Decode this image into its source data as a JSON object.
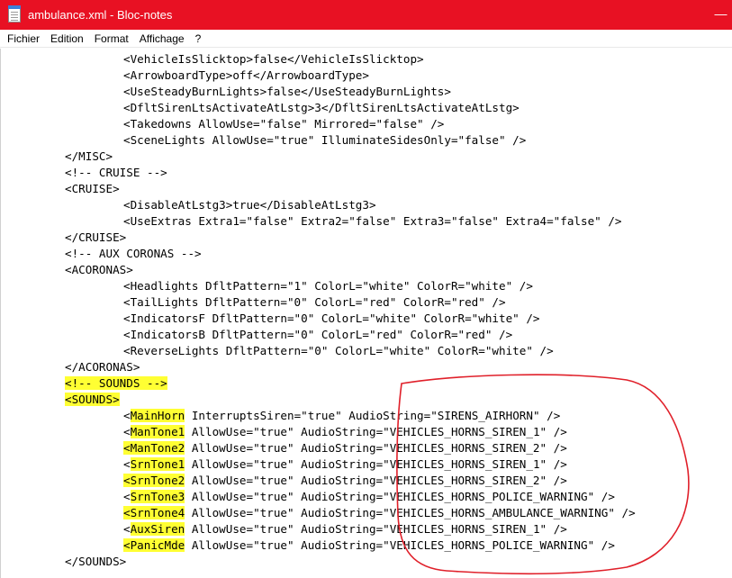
{
  "window": {
    "title": "ambulance.xml - Bloc-notes",
    "minimize_glyph": "—"
  },
  "menu": [
    "Fichier",
    "Edition",
    "Format",
    "Affichage",
    "?"
  ],
  "lines": [
    {
      "indent": 2,
      "segments": [
        {
          "t": "<VehicleIsSlicktop>false</VehicleIsSlicktop>"
        }
      ]
    },
    {
      "indent": 2,
      "segments": [
        {
          "t": "<ArrowboardType>off</ArrowboardType>"
        }
      ]
    },
    {
      "indent": 2,
      "segments": [
        {
          "t": "<UseSteadyBurnLights>false</UseSteadyBurnLights>"
        }
      ]
    },
    {
      "indent": 2,
      "segments": [
        {
          "t": "<DfltSirenLtsActivateAtLstg>3</DfltSirenLtsActivateAtLstg>"
        }
      ]
    },
    {
      "indent": 2,
      "segments": [
        {
          "t": "<Takedowns AllowUse=\"false\" Mirrored=\"false\" />"
        }
      ]
    },
    {
      "indent": 2,
      "segments": [
        {
          "t": "<SceneLights AllowUse=\"true\" IlluminateSidesOnly=\"false\" />"
        }
      ]
    },
    {
      "indent": 1,
      "segments": [
        {
          "t": "</MISC>"
        }
      ]
    },
    {
      "indent": 1,
      "segments": [
        {
          "t": "<!-- CRUISE -->"
        }
      ]
    },
    {
      "indent": 1,
      "segments": [
        {
          "t": "<CRUISE>"
        }
      ]
    },
    {
      "indent": 2,
      "segments": [
        {
          "t": "<DisableAtLstg3>true</DisableAtLstg3>"
        }
      ]
    },
    {
      "indent": 2,
      "segments": [
        {
          "t": "<UseExtras Extra1=\"false\" Extra2=\"false\" Extra3=\"false\" Extra4=\"false\" />"
        }
      ]
    },
    {
      "indent": 1,
      "segments": [
        {
          "t": "</CRUISE>"
        }
      ]
    },
    {
      "indent": 1,
      "segments": [
        {
          "t": "<!-- AUX CORONAS -->"
        }
      ]
    },
    {
      "indent": 1,
      "segments": [
        {
          "t": "<ACORONAS>"
        }
      ]
    },
    {
      "indent": 2,
      "segments": [
        {
          "t": "<Headlights DfltPattern=\"1\" ColorL=\"white\" ColorR=\"white\" />"
        }
      ]
    },
    {
      "indent": 2,
      "segments": [
        {
          "t": "<TailLights DfltPattern=\"0\" ColorL=\"red\" ColorR=\"red\" />"
        }
      ]
    },
    {
      "indent": 2,
      "segments": [
        {
          "t": "<IndicatorsF DfltPattern=\"0\" ColorL=\"white\" ColorR=\"white\" />"
        }
      ]
    },
    {
      "indent": 2,
      "segments": [
        {
          "t": "<IndicatorsB DfltPattern=\"0\" ColorL=\"red\" ColorR=\"red\" />"
        }
      ]
    },
    {
      "indent": 2,
      "segments": [
        {
          "t": "<ReverseLights DfltPattern=\"0\" ColorL=\"white\" ColorR=\"white\" />"
        }
      ]
    },
    {
      "indent": 1,
      "segments": [
        {
          "t": "</ACORONAS>"
        }
      ]
    },
    {
      "indent": 1,
      "segments": [
        {
          "t": "<!-- SOUNDS -->",
          "hl": true
        }
      ]
    },
    {
      "indent": 1,
      "segments": [
        {
          "t": "<SOUNDS>",
          "hl": true
        }
      ]
    },
    {
      "indent": 2,
      "segments": [
        {
          "t": "<"
        },
        {
          "t": "MainHorn",
          "hl": true
        },
        {
          "t": " InterruptsSiren=\"true\" AudioString=\"SIRENS_AIRHORN\" />"
        }
      ]
    },
    {
      "indent": 2,
      "segments": [
        {
          "t": "<"
        },
        {
          "t": "ManTone1",
          "hl": true
        },
        {
          "t": " AllowUse=\"true\" AudioString=\"VEHICLES_HORNS_SIREN_1\" />"
        }
      ]
    },
    {
      "indent": 2,
      "segments": [
        {
          "t": "<ManTone2",
          "hl": true
        },
        {
          "t": " AllowUse=\"true\" AudioString=\"VEHICLES_HORNS_SIREN_2\" />"
        }
      ]
    },
    {
      "indent": 2,
      "segments": [
        {
          "t": "<"
        },
        {
          "t": "SrnTone1",
          "hl": true
        },
        {
          "t": " AllowUse=\"true\" AudioString=\"VEHICLES_HORNS_SIREN_1\" />"
        }
      ]
    },
    {
      "indent": 2,
      "segments": [
        {
          "t": "<SrnTone2",
          "hl": true
        },
        {
          "t": " AllowUse=\"true\" AudioString=\"VEHICLES_HORNS_SIREN_2\" />"
        }
      ]
    },
    {
      "indent": 2,
      "segments": [
        {
          "t": "<"
        },
        {
          "t": "SrnTone3",
          "hl": true
        },
        {
          "t": " AllowUse=\"true\" AudioString=\"VEHICLES_HORNS_POLICE_WARNING\" />"
        }
      ]
    },
    {
      "indent": 2,
      "segments": [
        {
          "t": "<SrnTone4",
          "hl": true
        },
        {
          "t": " AllowUse=\"true\" AudioString=\"VEHICLES_HORNS_AMBULANCE_WARNING\" />"
        }
      ]
    },
    {
      "indent": 2,
      "segments": [
        {
          "t": "<"
        },
        {
          "t": "AuxSiren",
          "hl": true
        },
        {
          "t": " AllowUse=\"true\" AudioString=\"VEHICLES_HORNS_SIREN_1\" />"
        }
      ]
    },
    {
      "indent": 2,
      "segments": [
        {
          "t": "<PanicMde",
          "hl": true
        },
        {
          "t": " AllowUse=\"true\" AudioString=\"VEHICLES_HORNS_POLICE_WARNING\" />"
        }
      ]
    },
    {
      "indent": 1,
      "segments": [
        {
          "t": "</SOUNDS>"
        }
      ]
    }
  ],
  "colors": {
    "titlebar": "#e81123",
    "highlight": "#ffff33",
    "annotation_circle": "#e0202a"
  }
}
